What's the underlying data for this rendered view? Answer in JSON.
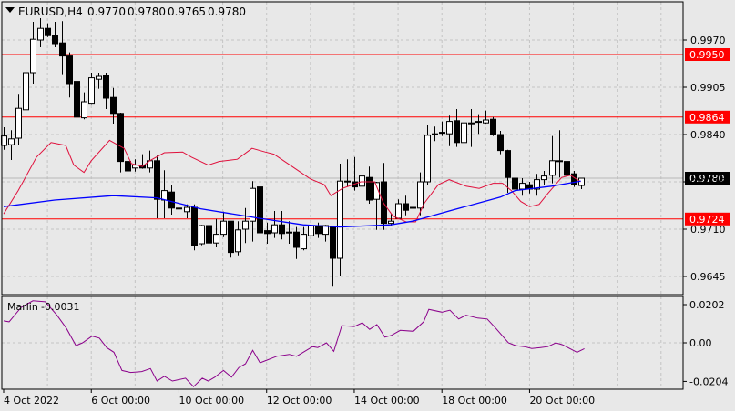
{
  "header": {
    "symbol": "EURUSD,H4",
    "open": "0.9770",
    "high": "0.9780",
    "low": "0.9765",
    "close": "0.9780"
  },
  "colors": {
    "background": "#e8e8e8",
    "level": "#ff0000",
    "ma_red": "#e0103c",
    "ma_blue": "#0000ff",
    "oscillator": "#8b008b",
    "bull": "#ffffff",
    "bear": "#000000"
  },
  "chart_data": [
    {
      "type": "candlestick",
      "title": "EURUSD,H4",
      "ylim": [
        0.961,
        1.0025
      ],
      "y_ticks": [
        "0.9970",
        "0.9905",
        "0.9840",
        "0.9775",
        "0.9710",
        "0.9645"
      ],
      "x_ticks": [
        {
          "bar": 0,
          "label": "4 Oct 2022"
        },
        {
          "bar": 12,
          "label": "6 Oct 00:00"
        },
        {
          "bar": 24,
          "label": "10 Oct 00:00"
        },
        {
          "bar": 36,
          "label": "12 Oct 00:00"
        },
        {
          "bar": 48,
          "label": "14 Oct 00:00"
        },
        {
          "bar": 60,
          "label": "18 Oct 00:00"
        },
        {
          "bar": 72,
          "label": "20 Oct 00:00"
        }
      ],
      "levels": [
        {
          "value": 0.995,
          "label": "0.9950"
        },
        {
          "value": 0.9864,
          "label": "0.9864"
        },
        {
          "value": 0.9724,
          "label": "0.9724"
        }
      ],
      "current_price": {
        "value": 0.978,
        "label": "0.9780"
      },
      "ohlc": [
        [
          0.9825,
          0.985,
          0.9819,
          0.9838
        ],
        [
          0.9826,
          0.9846,
          0.9805,
          0.9834
        ],
        [
          0.9835,
          0.9896,
          0.9825,
          0.9876
        ],
        [
          0.9874,
          0.9936,
          0.9853,
          0.9925
        ],
        [
          0.9925,
          0.9995,
          0.991,
          0.9971
        ],
        [
          0.997,
          1.0,
          0.996,
          0.9986
        ],
        [
          0.9986,
          0.9993,
          0.9974,
          0.9976
        ],
        [
          0.9976,
          0.9995,
          0.996,
          0.9965
        ],
        [
          0.9966,
          0.9996,
          0.9923,
          0.9948
        ],
        [
          0.9948,
          0.9953,
          0.9891,
          0.991
        ],
        [
          0.9913,
          0.9915,
          0.9835,
          0.9864
        ],
        [
          0.9863,
          0.9898,
          0.9861,
          0.9885
        ],
        [
          0.9883,
          0.9925,
          0.9882,
          0.9918
        ],
        [
          0.9916,
          0.9925,
          0.9903,
          0.992
        ],
        [
          0.9921,
          0.9925,
          0.9875,
          0.989
        ],
        [
          0.9891,
          0.9904,
          0.9855,
          0.9869
        ],
        [
          0.9869,
          0.987,
          0.9788,
          0.9803
        ],
        [
          0.9803,
          0.9818,
          0.9788,
          0.979
        ],
        [
          0.9794,
          0.9806,
          0.9789,
          0.9798
        ],
        [
          0.9798,
          0.9813,
          0.9793,
          0.9794
        ],
        [
          0.9794,
          0.9818,
          0.9788,
          0.9804
        ],
        [
          0.9804,
          0.9811,
          0.9725,
          0.9751
        ],
        [
          0.975,
          0.9791,
          0.9725,
          0.9763
        ],
        [
          0.9761,
          0.977,
          0.973,
          0.9739
        ],
        [
          0.9739,
          0.9744,
          0.9731,
          0.9738
        ],
        [
          0.9734,
          0.9744,
          0.9725,
          0.974
        ],
        [
          0.974,
          0.9744,
          0.9681,
          0.9688
        ],
        [
          0.969,
          0.9716,
          0.9688,
          0.9715
        ],
        [
          0.9715,
          0.9746,
          0.9688,
          0.9691
        ],
        [
          0.9691,
          0.9724,
          0.9685,
          0.9703
        ],
        [
          0.9703,
          0.9734,
          0.9699,
          0.9721
        ],
        [
          0.9721,
          0.9721,
          0.9671,
          0.9678
        ],
        [
          0.9679,
          0.9721,
          0.9674,
          0.9709
        ],
        [
          0.971,
          0.9739,
          0.9691,
          0.9721
        ],
        [
          0.9721,
          0.9776,
          0.9693,
          0.9766
        ],
        [
          0.9768,
          0.9768,
          0.9694,
          0.9705
        ],
        [
          0.9708,
          0.9719,
          0.969,
          0.9704
        ],
        [
          0.9705,
          0.9735,
          0.9698,
          0.9716
        ],
        [
          0.9716,
          0.9735,
          0.9696,
          0.9704
        ],
        [
          0.9706,
          0.9721,
          0.969,
          0.9706
        ],
        [
          0.9706,
          0.9713,
          0.9669,
          0.9685
        ],
        [
          0.9683,
          0.9713,
          0.9681,
          0.9703
        ],
        [
          0.9701,
          0.9723,
          0.9698,
          0.9715
        ],
        [
          0.9715,
          0.9719,
          0.9698,
          0.9704
        ],
        [
          0.9703,
          0.9716,
          0.9693,
          0.9715
        ],
        [
          0.9713,
          0.9713,
          0.9631,
          0.967
        ],
        [
          0.967,
          0.98,
          0.9646,
          0.9776
        ],
        [
          0.9776,
          0.9806,
          0.9768,
          0.9775
        ],
        [
          0.9775,
          0.9809,
          0.9763,
          0.9768
        ],
        [
          0.9769,
          0.9809,
          0.9769,
          0.9783
        ],
        [
          0.9781,
          0.9796,
          0.9745,
          0.975
        ],
        [
          0.9751,
          0.9775,
          0.9709,
          0.9774
        ],
        [
          0.9775,
          0.9801,
          0.9709,
          0.9718
        ],
        [
          0.9718,
          0.9731,
          0.9714,
          0.9721
        ],
        [
          0.9725,
          0.9751,
          0.9724,
          0.9745
        ],
        [
          0.9745,
          0.9756,
          0.9729,
          0.9736
        ],
        [
          0.974,
          0.9756,
          0.9725,
          0.9739
        ],
        [
          0.9739,
          0.9788,
          0.9729,
          0.9775
        ],
        [
          0.9775,
          0.9853,
          0.9771,
          0.9839
        ],
        [
          0.9841,
          0.9851,
          0.9831,
          0.9841
        ],
        [
          0.9843,
          0.9858,
          0.9838,
          0.9842
        ],
        [
          0.9841,
          0.9866,
          0.9824,
          0.9858
        ],
        [
          0.9859,
          0.9875,
          0.9823,
          0.9829
        ],
        [
          0.9829,
          0.9868,
          0.9813,
          0.9856
        ],
        [
          0.9856,
          0.9875,
          0.9823,
          0.9856
        ],
        [
          0.9858,
          0.9868,
          0.9841,
          0.9858
        ],
        [
          0.9856,
          0.9873,
          0.9855,
          0.986
        ],
        [
          0.9861,
          0.9864,
          0.9838,
          0.984
        ],
        [
          0.984,
          0.9845,
          0.9813,
          0.9818
        ],
        [
          0.9818,
          0.9819,
          0.976,
          0.9781
        ],
        [
          0.978,
          0.978,
          0.9765,
          0.9765
        ],
        [
          0.9765,
          0.978,
          0.9756,
          0.9773
        ],
        [
          0.9771,
          0.9775,
          0.9759,
          0.9765
        ],
        [
          0.9765,
          0.9786,
          0.9756,
          0.9778
        ],
        [
          0.9778,
          0.979,
          0.9771,
          0.9783
        ],
        [
          0.9784,
          0.9838,
          0.9773,
          0.9804
        ],
        [
          0.9803,
          0.9846,
          0.9781,
          0.9804
        ],
        [
          0.9803,
          0.9805,
          0.9775,
          0.9784
        ],
        [
          0.9786,
          0.979,
          0.9768,
          0.9771
        ],
        [
          0.977,
          0.978,
          0.9765,
          0.978
        ]
      ],
      "ma_blue": [
        [
          0,
          0.9741
        ],
        [
          7,
          0.975
        ],
        [
          15,
          0.9756
        ],
        [
          21,
          0.9753
        ],
        [
          27,
          0.9738
        ],
        [
          35,
          0.9725
        ],
        [
          41,
          0.9716
        ],
        [
          46,
          0.9713
        ],
        [
          53,
          0.9716
        ],
        [
          56,
          0.9721
        ],
        [
          61,
          0.9735
        ],
        [
          68,
          0.9754
        ],
        [
          70,
          0.9763
        ],
        [
          75,
          0.9769
        ],
        [
          79,
          0.9776
        ]
      ],
      "ma_red": [
        [
          0,
          0.9731
        ],
        [
          2,
          0.9763
        ],
        [
          4.5,
          0.9809
        ],
        [
          6.5,
          0.9829
        ],
        [
          8.5,
          0.9825
        ],
        [
          9.6,
          0.9798
        ],
        [
          11,
          0.9788
        ],
        [
          12,
          0.9804
        ],
        [
          14.5,
          0.9832
        ],
        [
          16.5,
          0.9821
        ],
        [
          17.5,
          0.98
        ],
        [
          19,
          0.9796
        ],
        [
          20,
          0.9804
        ],
        [
          22,
          0.9815
        ],
        [
          24.5,
          0.9816
        ],
        [
          25.7,
          0.9809
        ],
        [
          28,
          0.9798
        ],
        [
          29.5,
          0.9803
        ],
        [
          32,
          0.9806
        ],
        [
          34,
          0.9821
        ],
        [
          35.8,
          0.9816
        ],
        [
          37,
          0.9813
        ],
        [
          39.5,
          0.9796
        ],
        [
          42,
          0.9779
        ],
        [
          43.9,
          0.9771
        ],
        [
          44.8,
          0.9756
        ],
        [
          46.4,
          0.9766
        ],
        [
          48.9,
          0.9775
        ],
        [
          50.8,
          0.9775
        ],
        [
          52,
          0.9746
        ],
        [
          53.3,
          0.9728
        ],
        [
          55.1,
          0.972
        ],
        [
          56.4,
          0.972
        ],
        [
          57.6,
          0.9746
        ],
        [
          59.5,
          0.9771
        ],
        [
          61,
          0.9778
        ],
        [
          63.3,
          0.9769
        ],
        [
          65.1,
          0.9766
        ],
        [
          67,
          0.9773
        ],
        [
          68.3,
          0.9773
        ],
        [
          69.5,
          0.9763
        ],
        [
          70.8,
          0.9748
        ],
        [
          72,
          0.9741
        ],
        [
          73.3,
          0.9744
        ],
        [
          74.5,
          0.9759
        ],
        [
          76.4,
          0.9781
        ],
        [
          77.6,
          0.9784
        ],
        [
          79,
          0.9775
        ]
      ]
    },
    {
      "type": "line",
      "title": "Marlin",
      "value_label": "-0.0031",
      "ylim": [
        -0.0204,
        0.0202
      ],
      "y_ticks": [
        "0.0202",
        "0.00",
        "-0.0204"
      ],
      "series": [
        {
          "name": "Marlin",
          "points": [
            [
              0,
              0.0116
            ],
            [
              0.75,
              0.0111
            ],
            [
              2.4,
              0.0187
            ],
            [
              4,
              0.0222
            ],
            [
              5.7,
              0.0217
            ],
            [
              7.3,
              0.0146
            ],
            [
              8.6,
              0.0076
            ],
            [
              9.9,
              -0.0015
            ],
            [
              10.8,
              0
            ],
            [
              12.1,
              0.0035
            ],
            [
              13.1,
              0.0025
            ],
            [
              14.1,
              -0.0025
            ],
            [
              15.1,
              -0.005
            ],
            [
              16.2,
              -0.0146
            ],
            [
              17.4,
              -0.0157
            ],
            [
              18.9,
              -0.0152
            ],
            [
              20.1,
              -0.0136
            ],
            [
              21,
              -0.0202
            ],
            [
              22,
              -0.0177
            ],
            [
              23.1,
              -0.0202
            ],
            [
              24.9,
              -0.0187
            ],
            [
              26,
              -0.0232
            ],
            [
              27.2,
              -0.0187
            ],
            [
              28,
              -0.0202
            ],
            [
              28.9,
              -0.0182
            ],
            [
              30.1,
              -0.0146
            ],
            [
              31.2,
              -0.0182
            ],
            [
              32.2,
              -0.0131
            ],
            [
              33.1,
              -0.0111
            ],
            [
              34.1,
              -0.004
            ],
            [
              35.1,
              -0.0106
            ],
            [
              36.1,
              -0.0091
            ],
            [
              37.4,
              -0.0071
            ],
            [
              39.1,
              -0.0061
            ],
            [
              40.1,
              -0.0071
            ],
            [
              42.3,
              -0.002
            ],
            [
              43,
              -0.0025
            ],
            [
              44.2,
              0
            ],
            [
              45.2,
              -0.0045
            ],
            [
              46.3,
              0.0091
            ],
            [
              48,
              0.0086
            ],
            [
              49.1,
              0.0106
            ],
            [
              50.1,
              0.0071
            ],
            [
              51.1,
              0.0096
            ],
            [
              52.2,
              0.003
            ],
            [
              53.1,
              0.004
            ],
            [
              54.3,
              0.0066
            ],
            [
              56.1,
              0.0061
            ],
            [
              57.5,
              0.0111
            ],
            [
              58.2,
              0.0177
            ],
            [
              60,
              0.0162
            ],
            [
              61.1,
              0.0172
            ],
            [
              62.3,
              0.0126
            ],
            [
              63.3,
              0.0146
            ],
            [
              64.9,
              0.0131
            ],
            [
              66.2,
              0.0126
            ],
            [
              67.4,
              0.0076
            ],
            [
              69.1,
              0
            ],
            [
              70.1,
              -0.0015
            ],
            [
              71.3,
              -0.002
            ],
            [
              72.3,
              -0.003
            ],
            [
              73.5,
              -0.0025
            ],
            [
              74.5,
              -0.002
            ],
            [
              75.6,
              0
            ],
            [
              76.5,
              -0.001
            ],
            [
              78.5,
              -0.005
            ],
            [
              79.5,
              -0.0031
            ]
          ]
        }
      ]
    }
  ]
}
